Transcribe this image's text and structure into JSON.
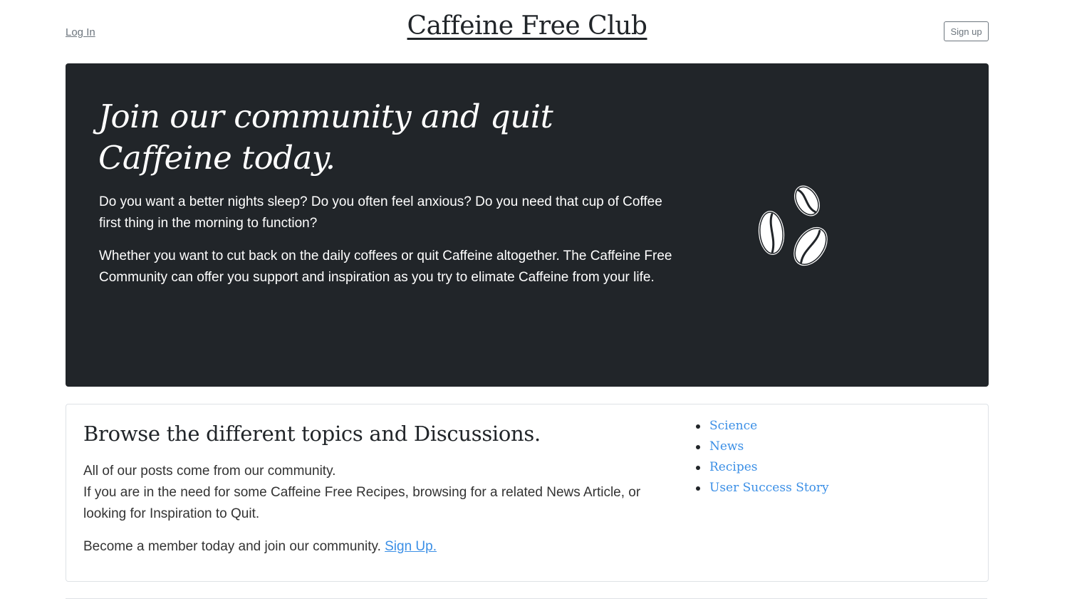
{
  "header": {
    "login_label": "Log In",
    "site_title": "Caffeine Free Club",
    "signup_label": "Sign up"
  },
  "hero": {
    "heading": "Join our community and quit Caffeine today.",
    "paragraph1": "Do you want a better nights sleep? Do you often feel anxious? Do you need that cup of Coffee first thing in the morning to function?",
    "paragraph2": "Whether you want to cut back on the daily coffees or quit Caffeine altogether. The Caffeine Free Community can offer you support and inspiration as you try to elimate Caffeine from your life.",
    "icon": "coffee-beans-icon",
    "background_color": "#212529"
  },
  "browse": {
    "heading": "Browse the different topics and Discussions.",
    "text_line1": "All of our posts come from our community.",
    "text_line2": "If you are in the need for some Caffeine Free Recipes, browsing for a related News Article, or looking for Inspiration to Quit.",
    "member_text": "Become a member today and join our community.",
    "signup_link": "Sign Up.",
    "topics": [
      "Science",
      "News",
      "Recipes",
      "User Success Story"
    ],
    "link_color": "#3b8fe6"
  }
}
